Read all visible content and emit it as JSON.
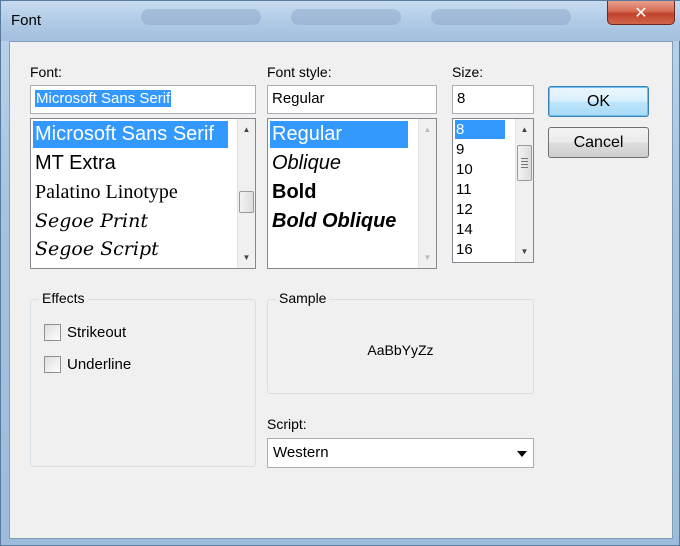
{
  "window": {
    "title": "Font",
    "close_glyph": "✕"
  },
  "font": {
    "label": "Font:",
    "value": "Microsoft Sans Serif",
    "items": [
      "Microsoft Sans Serif",
      "MT Extra",
      "Palatino Linotype",
      "Segoe Print",
      "Segoe Script"
    ],
    "selected_index": 0
  },
  "style": {
    "label": "Font style:",
    "value": "Regular",
    "items": [
      "Regular",
      "Oblique",
      "Bold",
      "Bold Oblique"
    ],
    "selected_index": 0
  },
  "size": {
    "label": "Size:",
    "value": "8",
    "items": [
      "8",
      "9",
      "10",
      "11",
      "12",
      "14",
      "16"
    ],
    "selected_index": 0
  },
  "buttons": {
    "ok": "OK",
    "cancel": "Cancel"
  },
  "effects": {
    "title": "Effects",
    "strikeout": "Strikeout",
    "underline": "Underline",
    "strikeout_checked": false,
    "underline_checked": false
  },
  "sample": {
    "title": "Sample",
    "text": "AaBbYyZz"
  },
  "script": {
    "label": "Script:",
    "value": "Western"
  },
  "colors": {
    "selection": "#3399ff",
    "close_button": "#c7432b",
    "default_button_border": "#3c7fb1"
  }
}
